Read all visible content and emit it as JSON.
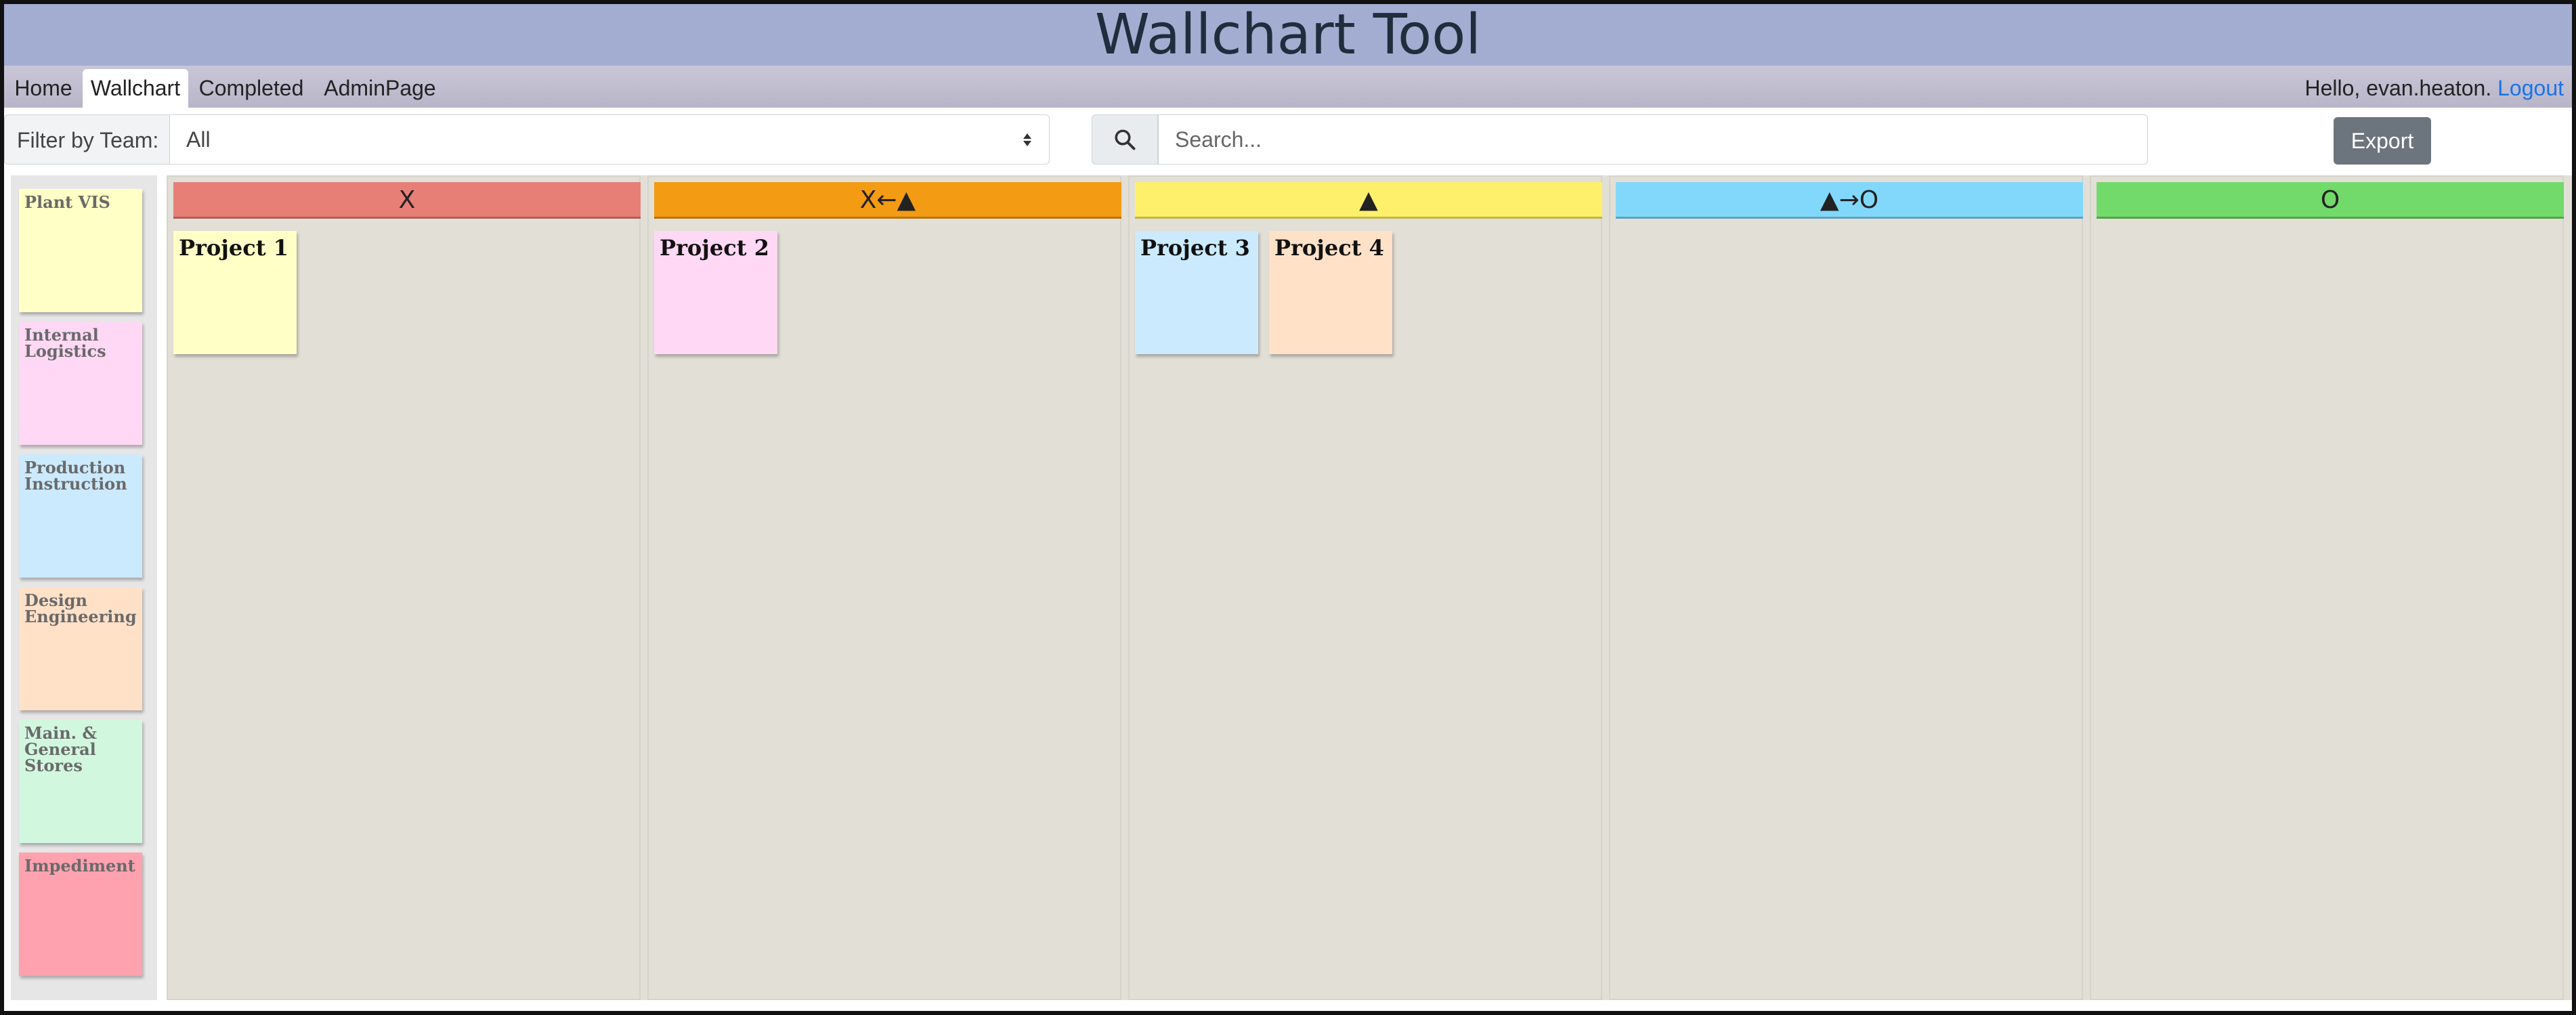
{
  "app": {
    "title": "Wallchart Tool"
  },
  "nav": {
    "tabs": [
      {
        "label": "Home",
        "active": false
      },
      {
        "label": "Wallchart",
        "active": true
      },
      {
        "label": "Completed",
        "active": false
      },
      {
        "label": "AdminPage",
        "active": false
      }
    ],
    "greeting": "Hello, evan.heaton.",
    "logout_label": "Logout"
  },
  "toolbar": {
    "filter_label": "Filter by Team:",
    "filter_value": "All",
    "search_placeholder": "Search...",
    "search_value": "",
    "export_label": "Export"
  },
  "legend": {
    "items": [
      {
        "label": "Plant VIS",
        "color": "#ffffc6"
      },
      {
        "label": "Internal Logistics",
        "color": "#ffd8f5"
      },
      {
        "label": "Production Instruction",
        "color": "#cbeafd"
      },
      {
        "label": "Design Engineering",
        "color": "#ffe1c8"
      },
      {
        "label": "Main. & General Stores",
        "color": "#d2f7df"
      },
      {
        "label": "Impediment",
        "color": "#ffa2b0"
      }
    ]
  },
  "board": {
    "columns": [
      {
        "label": "X",
        "color": "#e77f77",
        "cards": [
          {
            "label": "Project 1",
            "color": "#ffffc6"
          }
        ]
      },
      {
        "label": "X←▲",
        "color": "#f29b13",
        "cards": [
          {
            "label": "Project 2",
            "color": "#ffd8f5"
          }
        ]
      },
      {
        "label": "▲",
        "color": "#fff06b",
        "cards": [
          {
            "label": "Project 3",
            "color": "#cbeafd"
          },
          {
            "label": "Project 4",
            "color": "#ffe1c8"
          }
        ]
      },
      {
        "label": "▲→O",
        "color": "#82d8fb",
        "cards": []
      },
      {
        "label": "O",
        "color": "#72da6a",
        "cards": []
      }
    ]
  }
}
